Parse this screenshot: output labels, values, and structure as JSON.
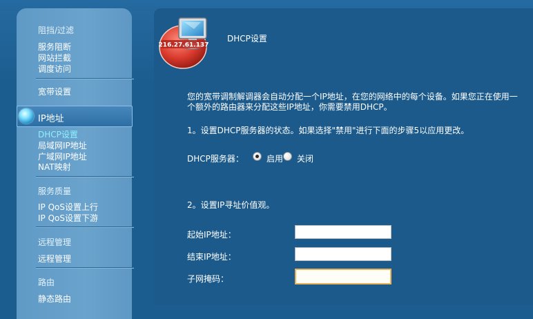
{
  "sidebar": {
    "sections": [
      {
        "heading": "阻挡/过滤",
        "items": [
          "服务阻断",
          "网站拦截",
          "调度访问"
        ]
      },
      {
        "heading": "宽带设置",
        "items": []
      },
      {
        "heading": "IP地址",
        "items": [
          "DHCP设置",
          "局域网IP地址",
          "广域网IP地址",
          "NAT映射"
        ]
      },
      {
        "heading": "服务质量",
        "items": [
          "IP QoS设置上行",
          "IP QoS设置下游"
        ]
      },
      {
        "heading": "远程管理",
        "items": [
          "远程管理"
        ]
      },
      {
        "heading": "路由",
        "items": [
          "静态路由"
        ]
      }
    ],
    "active_section": "IP地址",
    "active_item": "DHCP设置"
  },
  "logo": {
    "text": "216.27.61.137",
    "icon": "monitor-icon"
  },
  "page": {
    "title": "DHCP设置",
    "intro": "您的宽带调制解调器会自动分配一个IP地址，在您的网络中的每个设备。如果您正在使用一个额外的路由器来分配这些IP地址，你需要禁用DHCP。",
    "step1": "1。设置DHCP服务器的状态。如果选择\"禁用\"进行下面的步骤5以应用更改。",
    "dhcp_server_label": "DHCP服务器：",
    "enable_label": "启用",
    "disable_label": "关闭",
    "dhcp_enabled": true,
    "step2": "2。设置IP寻址价值观。",
    "fields": {
      "start_ip_label": "起始IP地址：",
      "start_ip_value": "",
      "end_ip_label": "结束IP地址：",
      "end_ip_value": "",
      "subnet_label": "子网掩码：",
      "subnet_value": ""
    }
  },
  "colors": {
    "background": "#1c5d8f",
    "sidebar": "#6aa3cc",
    "active_item": "#8ff0ff",
    "focus_border": "#e9b35b"
  }
}
